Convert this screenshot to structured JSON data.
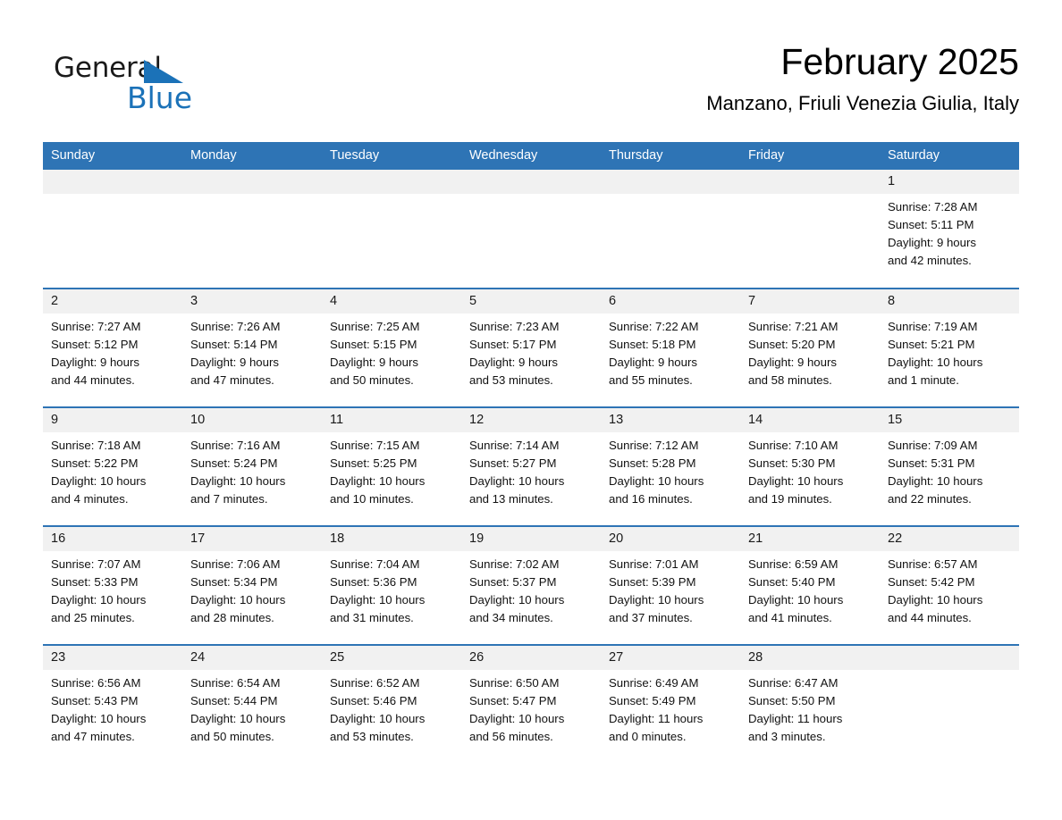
{
  "brand": {
    "name_part1": "General",
    "name_part2": "Blue",
    "accent_color": "#1b72b8"
  },
  "header": {
    "title": "February 2025",
    "subtitle": "Manzano, Friuli Venezia Giulia, Italy"
  },
  "calendar": {
    "header_color": "#2e74b5",
    "daynum_band_color": "#f1f1f1",
    "weekday_headers": [
      "Sunday",
      "Monday",
      "Tuesday",
      "Wednesday",
      "Thursday",
      "Friday",
      "Saturday"
    ],
    "weeks": [
      [
        {
          "day": "",
          "sunrise": "",
          "sunset": "",
          "daylight1": "",
          "daylight2": ""
        },
        {
          "day": "",
          "sunrise": "",
          "sunset": "",
          "daylight1": "",
          "daylight2": ""
        },
        {
          "day": "",
          "sunrise": "",
          "sunset": "",
          "daylight1": "",
          "daylight2": ""
        },
        {
          "day": "",
          "sunrise": "",
          "sunset": "",
          "daylight1": "",
          "daylight2": ""
        },
        {
          "day": "",
          "sunrise": "",
          "sunset": "",
          "daylight1": "",
          "daylight2": ""
        },
        {
          "day": "",
          "sunrise": "",
          "sunset": "",
          "daylight1": "",
          "daylight2": ""
        },
        {
          "day": "1",
          "sunrise": "Sunrise: 7:28 AM",
          "sunset": "Sunset: 5:11 PM",
          "daylight1": "Daylight: 9 hours",
          "daylight2": "and 42 minutes."
        }
      ],
      [
        {
          "day": "2",
          "sunrise": "Sunrise: 7:27 AM",
          "sunset": "Sunset: 5:12 PM",
          "daylight1": "Daylight: 9 hours",
          "daylight2": "and 44 minutes."
        },
        {
          "day": "3",
          "sunrise": "Sunrise: 7:26 AM",
          "sunset": "Sunset: 5:14 PM",
          "daylight1": "Daylight: 9 hours",
          "daylight2": "and 47 minutes."
        },
        {
          "day": "4",
          "sunrise": "Sunrise: 7:25 AM",
          "sunset": "Sunset: 5:15 PM",
          "daylight1": "Daylight: 9 hours",
          "daylight2": "and 50 minutes."
        },
        {
          "day": "5",
          "sunrise": "Sunrise: 7:23 AM",
          "sunset": "Sunset: 5:17 PM",
          "daylight1": "Daylight: 9 hours",
          "daylight2": "and 53 minutes."
        },
        {
          "day": "6",
          "sunrise": "Sunrise: 7:22 AM",
          "sunset": "Sunset: 5:18 PM",
          "daylight1": "Daylight: 9 hours",
          "daylight2": "and 55 minutes."
        },
        {
          "day": "7",
          "sunrise": "Sunrise: 7:21 AM",
          "sunset": "Sunset: 5:20 PM",
          "daylight1": "Daylight: 9 hours",
          "daylight2": "and 58 minutes."
        },
        {
          "day": "8",
          "sunrise": "Sunrise: 7:19 AM",
          "sunset": "Sunset: 5:21 PM",
          "daylight1": "Daylight: 10 hours",
          "daylight2": "and 1 minute."
        }
      ],
      [
        {
          "day": "9",
          "sunrise": "Sunrise: 7:18 AM",
          "sunset": "Sunset: 5:22 PM",
          "daylight1": "Daylight: 10 hours",
          "daylight2": "and 4 minutes."
        },
        {
          "day": "10",
          "sunrise": "Sunrise: 7:16 AM",
          "sunset": "Sunset: 5:24 PM",
          "daylight1": "Daylight: 10 hours",
          "daylight2": "and 7 minutes."
        },
        {
          "day": "11",
          "sunrise": "Sunrise: 7:15 AM",
          "sunset": "Sunset: 5:25 PM",
          "daylight1": "Daylight: 10 hours",
          "daylight2": "and 10 minutes."
        },
        {
          "day": "12",
          "sunrise": "Sunrise: 7:14 AM",
          "sunset": "Sunset: 5:27 PM",
          "daylight1": "Daylight: 10 hours",
          "daylight2": "and 13 minutes."
        },
        {
          "day": "13",
          "sunrise": "Sunrise: 7:12 AM",
          "sunset": "Sunset: 5:28 PM",
          "daylight1": "Daylight: 10 hours",
          "daylight2": "and 16 minutes."
        },
        {
          "day": "14",
          "sunrise": "Sunrise: 7:10 AM",
          "sunset": "Sunset: 5:30 PM",
          "daylight1": "Daylight: 10 hours",
          "daylight2": "and 19 minutes."
        },
        {
          "day": "15",
          "sunrise": "Sunrise: 7:09 AM",
          "sunset": "Sunset: 5:31 PM",
          "daylight1": "Daylight: 10 hours",
          "daylight2": "and 22 minutes."
        }
      ],
      [
        {
          "day": "16",
          "sunrise": "Sunrise: 7:07 AM",
          "sunset": "Sunset: 5:33 PM",
          "daylight1": "Daylight: 10 hours",
          "daylight2": "and 25 minutes."
        },
        {
          "day": "17",
          "sunrise": "Sunrise: 7:06 AM",
          "sunset": "Sunset: 5:34 PM",
          "daylight1": "Daylight: 10 hours",
          "daylight2": "and 28 minutes."
        },
        {
          "day": "18",
          "sunrise": "Sunrise: 7:04 AM",
          "sunset": "Sunset: 5:36 PM",
          "daylight1": "Daylight: 10 hours",
          "daylight2": "and 31 minutes."
        },
        {
          "day": "19",
          "sunrise": "Sunrise: 7:02 AM",
          "sunset": "Sunset: 5:37 PM",
          "daylight1": "Daylight: 10 hours",
          "daylight2": "and 34 minutes."
        },
        {
          "day": "20",
          "sunrise": "Sunrise: 7:01 AM",
          "sunset": "Sunset: 5:39 PM",
          "daylight1": "Daylight: 10 hours",
          "daylight2": "and 37 minutes."
        },
        {
          "day": "21",
          "sunrise": "Sunrise: 6:59 AM",
          "sunset": "Sunset: 5:40 PM",
          "daylight1": "Daylight: 10 hours",
          "daylight2": "and 41 minutes."
        },
        {
          "day": "22",
          "sunrise": "Sunrise: 6:57 AM",
          "sunset": "Sunset: 5:42 PM",
          "daylight1": "Daylight: 10 hours",
          "daylight2": "and 44 minutes."
        }
      ],
      [
        {
          "day": "23",
          "sunrise": "Sunrise: 6:56 AM",
          "sunset": "Sunset: 5:43 PM",
          "daylight1": "Daylight: 10 hours",
          "daylight2": "and 47 minutes."
        },
        {
          "day": "24",
          "sunrise": "Sunrise: 6:54 AM",
          "sunset": "Sunset: 5:44 PM",
          "daylight1": "Daylight: 10 hours",
          "daylight2": "and 50 minutes."
        },
        {
          "day": "25",
          "sunrise": "Sunrise: 6:52 AM",
          "sunset": "Sunset: 5:46 PM",
          "daylight1": "Daylight: 10 hours",
          "daylight2": "and 53 minutes."
        },
        {
          "day": "26",
          "sunrise": "Sunrise: 6:50 AM",
          "sunset": "Sunset: 5:47 PM",
          "daylight1": "Daylight: 10 hours",
          "daylight2": "and 56 minutes."
        },
        {
          "day": "27",
          "sunrise": "Sunrise: 6:49 AM",
          "sunset": "Sunset: 5:49 PM",
          "daylight1": "Daylight: 11 hours",
          "daylight2": "and 0 minutes."
        },
        {
          "day": "28",
          "sunrise": "Sunrise: 6:47 AM",
          "sunset": "Sunset: 5:50 PM",
          "daylight1": "Daylight: 11 hours",
          "daylight2": "and 3 minutes."
        },
        {
          "day": "",
          "sunrise": "",
          "sunset": "",
          "daylight1": "",
          "daylight2": ""
        }
      ]
    ]
  }
}
